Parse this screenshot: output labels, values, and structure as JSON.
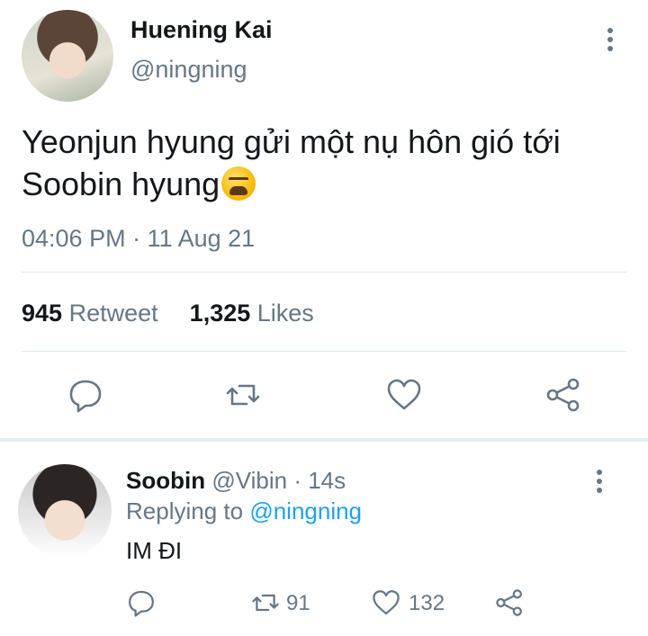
{
  "tweet": {
    "author_name": "Huening Kai",
    "author_handle": "@ningning",
    "text": "Yeonjun hyung gửi một nụ hôn gió tới Soobin hyung",
    "timestamp": "04:06 PM · 11 Aug 21",
    "retweet_count": "945",
    "retweet_label": "Retweet",
    "like_count": "1,325",
    "like_label": "Likes"
  },
  "reply": {
    "author_name": "Soobin",
    "author_handle": "@Vibin",
    "time_ago": "· 14s",
    "replying_to_label": "Replying to",
    "replying_to_handle": "@ningning",
    "text": "IM ĐI",
    "retweet_count": "91",
    "like_count": "132"
  },
  "icons": [
    "reply-icon",
    "retweet-icon",
    "like-icon",
    "share-icon",
    "more-icon",
    "weary-face-emoji"
  ],
  "colors": {
    "text": "#14171a",
    "secondary": "#657786",
    "link": "#1da1f2",
    "divider": "#e1e8ed"
  }
}
